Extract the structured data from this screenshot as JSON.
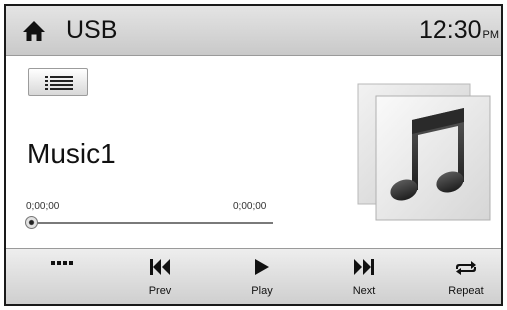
{
  "header": {
    "home_icon": "home-icon",
    "title": "USB",
    "clock_time": "12:30",
    "clock_ampm": "PM"
  },
  "main": {
    "list_icon": "list-icon",
    "track_title": "Music1",
    "time_elapsed": "0;00;00",
    "time_total": "0;00;00",
    "progress_fraction": 0,
    "album_art_icon": "music-note-icon"
  },
  "controls": {
    "more_icon": "more-dots-icon",
    "prev_label": "Prev",
    "play_label": "Play",
    "next_label": "Next",
    "repeat_label": "Repeat"
  }
}
